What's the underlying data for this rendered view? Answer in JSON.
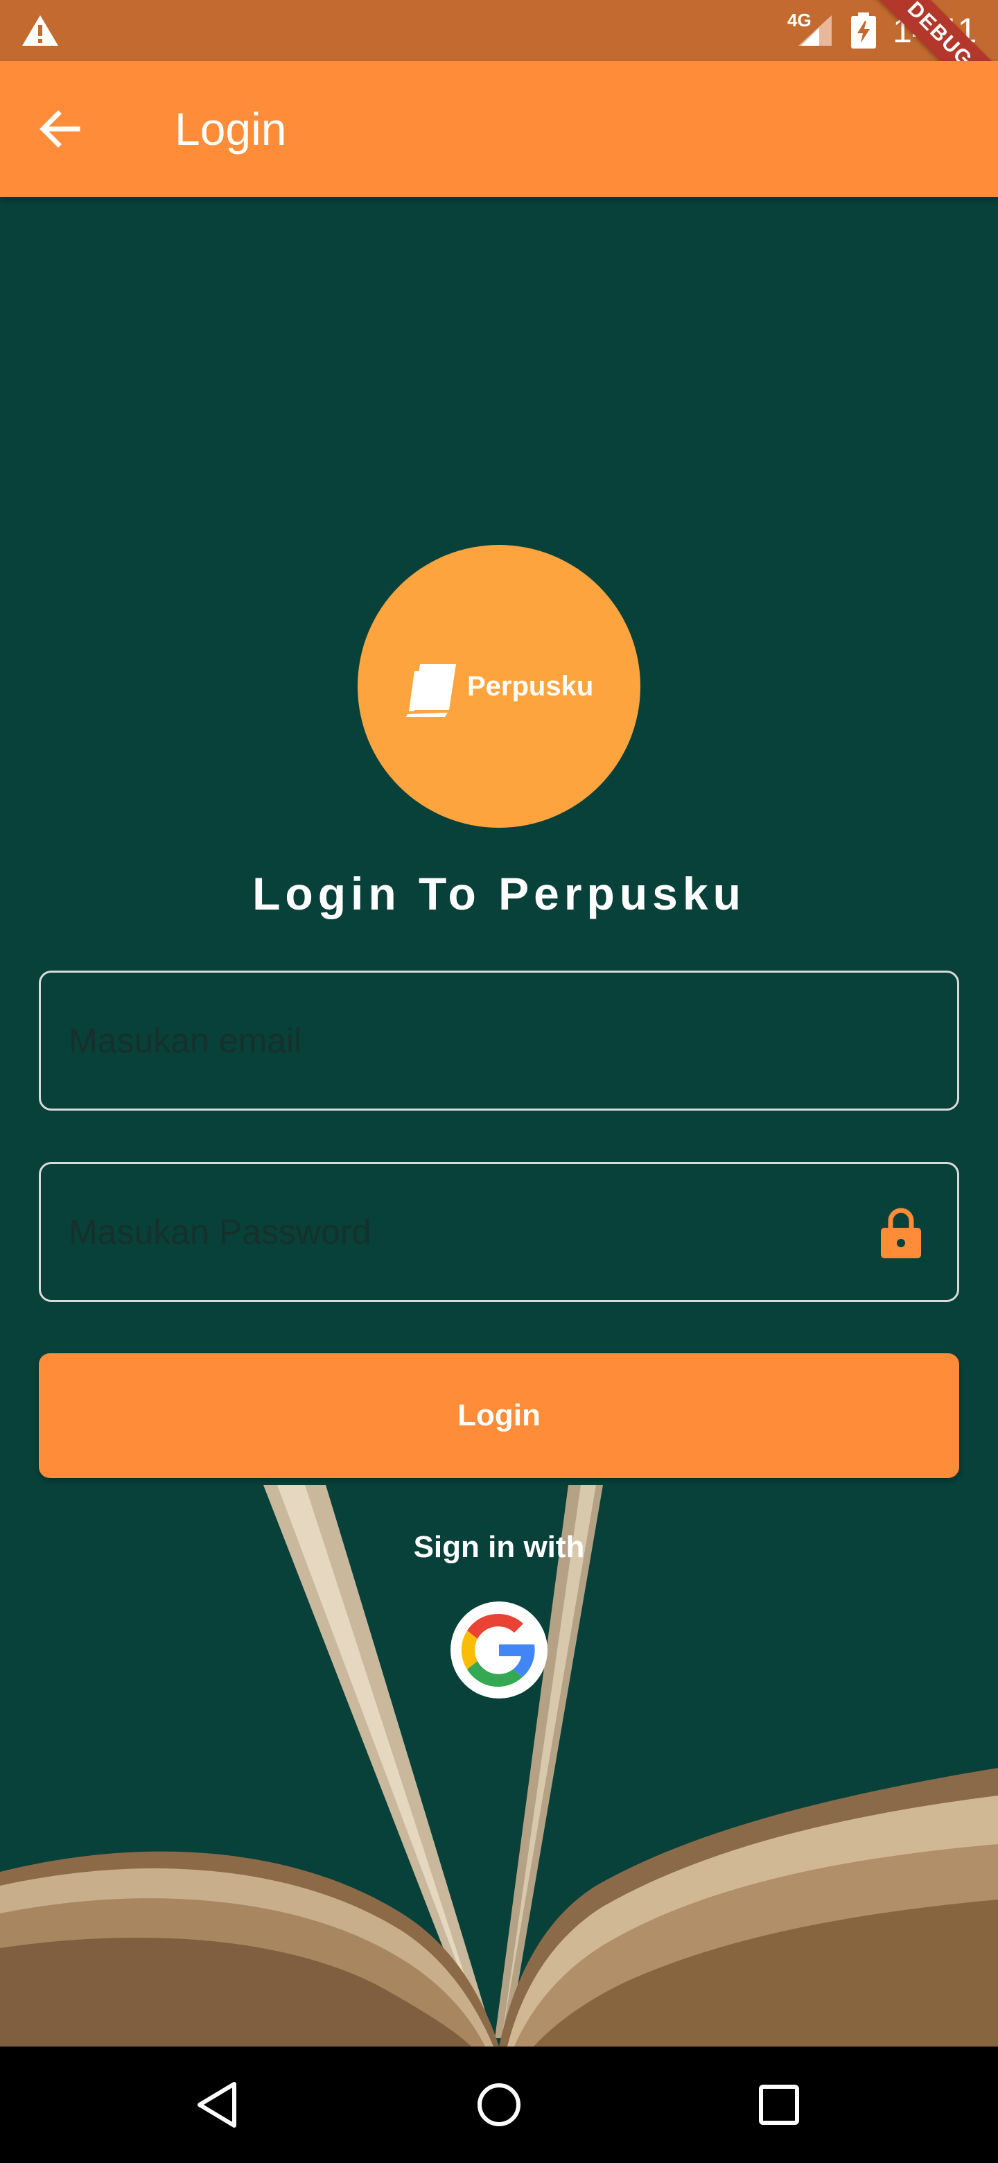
{
  "status_bar": {
    "network": "4G",
    "time": "14:11",
    "icons": [
      "warning-icon",
      "signal-icon",
      "battery-charging-icon"
    ],
    "debug_banner": "DEBUG"
  },
  "app_bar": {
    "title": "Login",
    "back_icon": "arrow-back-icon",
    "color": "#fe8c38"
  },
  "logo": {
    "text": "Perpusku",
    "icon": "book-logo-icon",
    "circle_color": "#fea43f"
  },
  "heading": "Login To Perpusku",
  "email_field": {
    "placeholder": "Masukan email",
    "value": ""
  },
  "password_field": {
    "placeholder": "Masukan Password",
    "value": "",
    "trailing_icon": "lock-icon"
  },
  "login_button": {
    "label": "Login"
  },
  "sign_in_with": "Sign in with",
  "google_button": {
    "icon": "google-icon"
  },
  "nav_bar": {
    "icons": [
      "nav-back-icon",
      "nav-home-icon",
      "nav-recents-icon"
    ]
  },
  "colors": {
    "background": "#08403a",
    "accent": "#fe8c38",
    "status_bar": "#c26a2f"
  }
}
